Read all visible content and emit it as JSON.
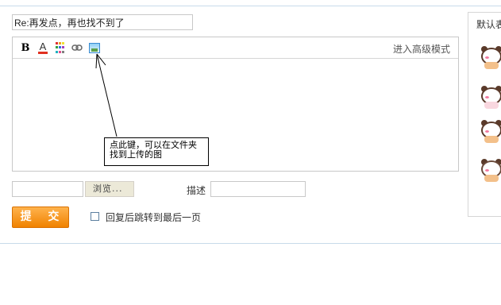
{
  "reply": {
    "title_value": "Re:再发点，再也找不到了"
  },
  "toolbar": {
    "bold_label": "B",
    "font_color_label": "A",
    "advanced_mode_label": "进入高级模式",
    "icons": [
      "bold-icon",
      "font-color-icon",
      "color-grid-icon",
      "link-icon",
      "image-icon"
    ]
  },
  "annotation": {
    "line1": "点此键，可以在文件夹",
    "line2": "找到上传的图"
  },
  "upload": {
    "browse_label": "浏览...",
    "description_label": "描述"
  },
  "actions": {
    "submit_label": "提 交",
    "jump_last_page_label": "回复后跳转到最后一页"
  },
  "sidebar": {
    "title": "默认表情",
    "emoticons": [
      "panda-emoticon-1",
      "panda-emoticon-2",
      "panda-emoticon-3",
      "panda-emoticon-4"
    ]
  },
  "colors": {
    "submit_button": "#f08200",
    "border": "#c7dbea",
    "font_color_bar": "#e03020"
  }
}
